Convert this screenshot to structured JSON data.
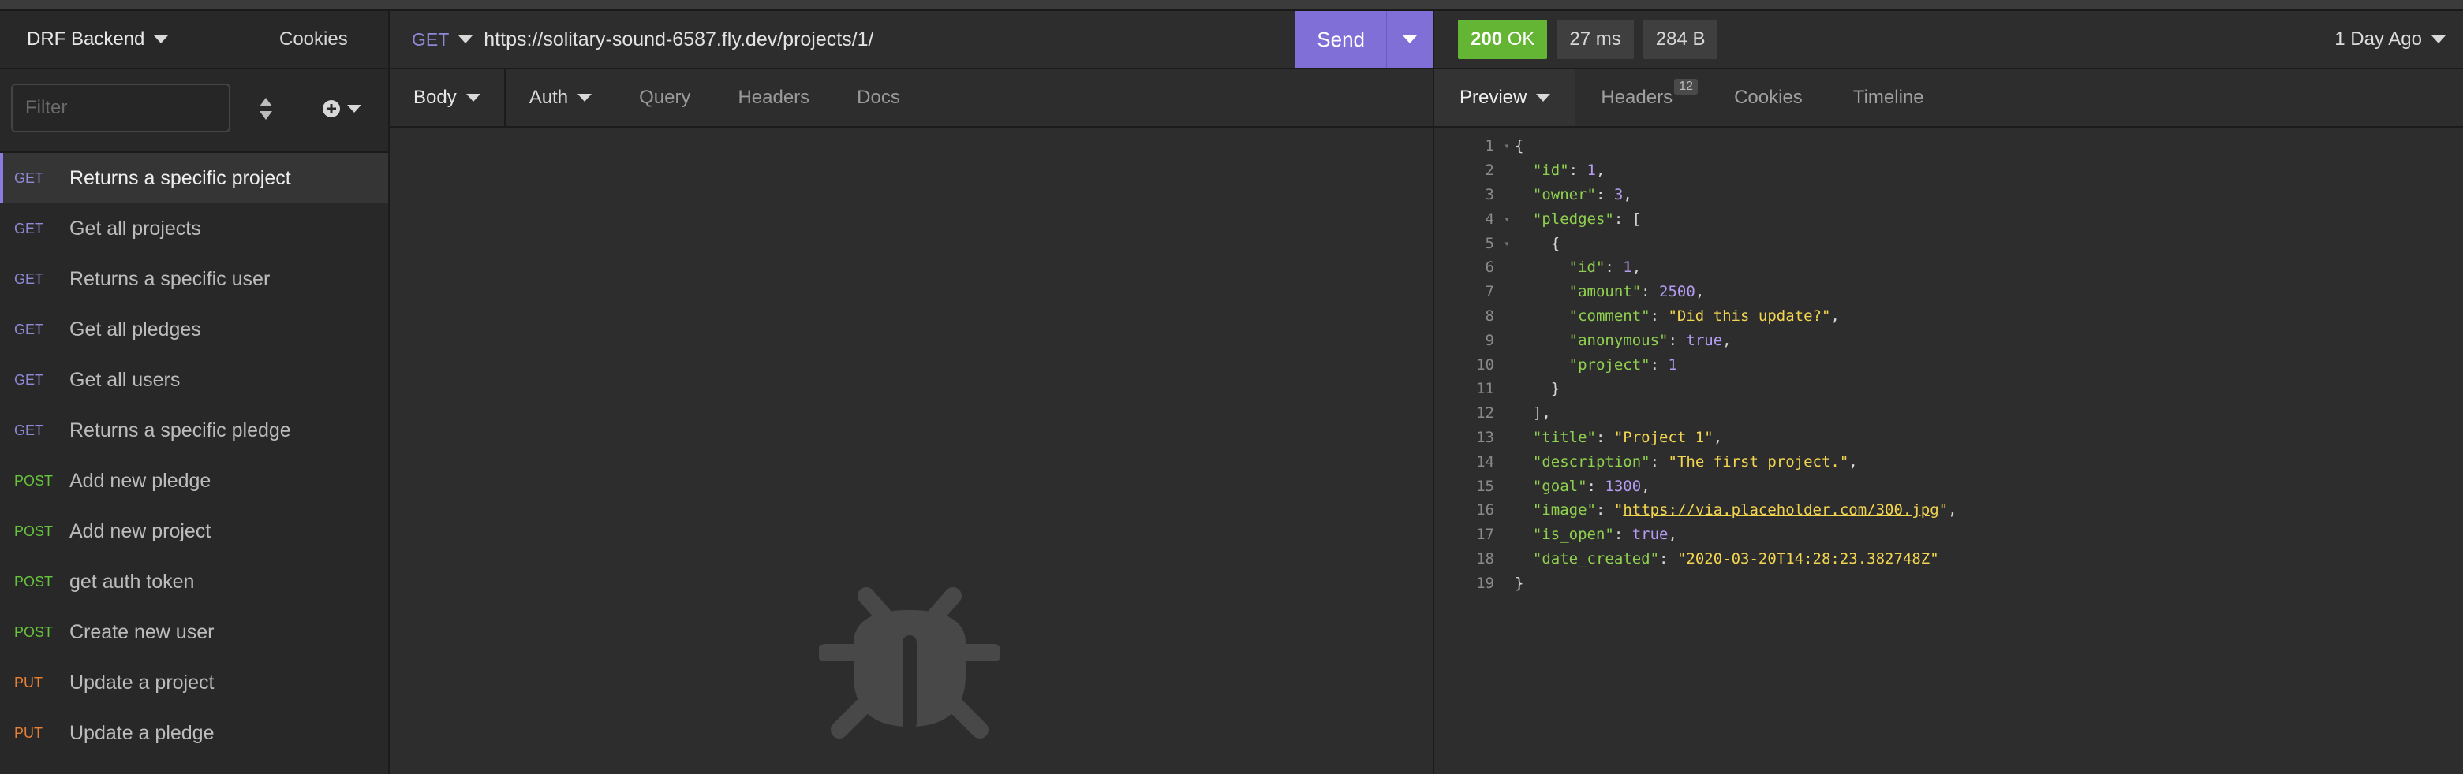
{
  "sidebar": {
    "workspace": "DRF Backend",
    "cookies": "Cookies",
    "filter_placeholder": "Filter",
    "requests": [
      {
        "method": "GET",
        "name": "Returns a specific project",
        "active": true
      },
      {
        "method": "GET",
        "name": "Get all projects"
      },
      {
        "method": "GET",
        "name": "Returns a specific user"
      },
      {
        "method": "GET",
        "name": "Get all pledges"
      },
      {
        "method": "GET",
        "name": "Get all users"
      },
      {
        "method": "GET",
        "name": "Returns a specific pledge"
      },
      {
        "method": "POST",
        "name": "Add new pledge"
      },
      {
        "method": "POST",
        "name": "Add new project"
      },
      {
        "method": "POST",
        "name": "get auth token"
      },
      {
        "method": "POST",
        "name": "Create new user"
      },
      {
        "method": "PUT",
        "name": "Update a project"
      },
      {
        "method": "PUT",
        "name": "Update a pledge"
      }
    ]
  },
  "request": {
    "method": "GET",
    "url": "https://solitary-sound-6587.fly.dev/projects/1/",
    "send_label": "Send",
    "tabs": {
      "body": "Body",
      "auth": "Auth",
      "query": "Query",
      "headers": "Headers",
      "docs": "Docs"
    }
  },
  "response": {
    "status_code": "200",
    "status_text": "OK",
    "time": "27 ms",
    "size": "284 B",
    "age": "1 Day Ago",
    "tabs": {
      "preview": "Preview",
      "headers": "Headers",
      "headers_count": "12",
      "cookies": "Cookies",
      "timeline": "Timeline"
    },
    "lines": [
      {
        "n": "1",
        "fold": true,
        "t": [
          [
            "p",
            "{"
          ]
        ]
      },
      {
        "n": "2",
        "t": [
          [
            "p",
            "  "
          ],
          [
            "k",
            "\"id\""
          ],
          [
            "p",
            ": "
          ],
          [
            "num",
            "1"
          ],
          [
            "p",
            ","
          ]
        ]
      },
      {
        "n": "3",
        "t": [
          [
            "p",
            "  "
          ],
          [
            "k",
            "\"owner\""
          ],
          [
            "p",
            ": "
          ],
          [
            "num",
            "3"
          ],
          [
            "p",
            ","
          ]
        ]
      },
      {
        "n": "4",
        "fold": true,
        "t": [
          [
            "p",
            "  "
          ],
          [
            "k",
            "\"pledges\""
          ],
          [
            "p",
            ": ["
          ]
        ]
      },
      {
        "n": "5",
        "fold": true,
        "t": [
          [
            "p",
            "    {"
          ]
        ]
      },
      {
        "n": "6",
        "t": [
          [
            "p",
            "      "
          ],
          [
            "k",
            "\"id\""
          ],
          [
            "p",
            ": "
          ],
          [
            "num",
            "1"
          ],
          [
            "p",
            ","
          ]
        ]
      },
      {
        "n": "7",
        "t": [
          [
            "p",
            "      "
          ],
          [
            "k",
            "\"amount\""
          ],
          [
            "p",
            ": "
          ],
          [
            "num",
            "2500"
          ],
          [
            "p",
            ","
          ]
        ]
      },
      {
        "n": "8",
        "t": [
          [
            "p",
            "      "
          ],
          [
            "k",
            "\"comment\""
          ],
          [
            "p",
            ": "
          ],
          [
            "str",
            "\"Did this update?\""
          ],
          [
            "p",
            ","
          ]
        ]
      },
      {
        "n": "9",
        "t": [
          [
            "p",
            "      "
          ],
          [
            "k",
            "\"anonymous\""
          ],
          [
            "p",
            ": "
          ],
          [
            "num",
            "true"
          ],
          [
            "p",
            ","
          ]
        ]
      },
      {
        "n": "10",
        "t": [
          [
            "p",
            "      "
          ],
          [
            "k",
            "\"project\""
          ],
          [
            "p",
            ": "
          ],
          [
            "num",
            "1"
          ]
        ]
      },
      {
        "n": "11",
        "t": [
          [
            "p",
            "    }"
          ]
        ]
      },
      {
        "n": "12",
        "t": [
          [
            "p",
            "  ],"
          ]
        ]
      },
      {
        "n": "13",
        "t": [
          [
            "p",
            "  "
          ],
          [
            "k",
            "\"title\""
          ],
          [
            "p",
            ": "
          ],
          [
            "str",
            "\"Project 1\""
          ],
          [
            "p",
            ","
          ]
        ]
      },
      {
        "n": "14",
        "t": [
          [
            "p",
            "  "
          ],
          [
            "k",
            "\"description\""
          ],
          [
            "p",
            ": "
          ],
          [
            "str",
            "\"The first project.\""
          ],
          [
            "p",
            ","
          ]
        ]
      },
      {
        "n": "15",
        "t": [
          [
            "p",
            "  "
          ],
          [
            "k",
            "\"goal\""
          ],
          [
            "p",
            ": "
          ],
          [
            "num",
            "1300"
          ],
          [
            "p",
            ","
          ]
        ]
      },
      {
        "n": "16",
        "t": [
          [
            "p",
            "  "
          ],
          [
            "k",
            "\"image\""
          ],
          [
            "p",
            ": "
          ],
          [
            "str",
            "\""
          ],
          [
            "lnk",
            "https://via.placeholder.com/300.jpg"
          ],
          [
            "str",
            "\""
          ],
          [
            "p",
            ","
          ]
        ]
      },
      {
        "n": "17",
        "t": [
          [
            "p",
            "  "
          ],
          [
            "k",
            "\"is_open\""
          ],
          [
            "p",
            ": "
          ],
          [
            "num",
            "true"
          ],
          [
            "p",
            ","
          ]
        ]
      },
      {
        "n": "18",
        "t": [
          [
            "p",
            "  "
          ],
          [
            "k",
            "\"date_created\""
          ],
          [
            "p",
            ": "
          ],
          [
            "str",
            "\"2020-03-20T14:28:23.382748Z\""
          ]
        ]
      },
      {
        "n": "19",
        "t": [
          [
            "p",
            "}"
          ]
        ]
      }
    ]
  },
  "colors": {
    "accent": "#7f6fd6",
    "ok": "#64b534",
    "get": "#8f8ad8",
    "post": "#67c33c",
    "put": "#e78034"
  }
}
